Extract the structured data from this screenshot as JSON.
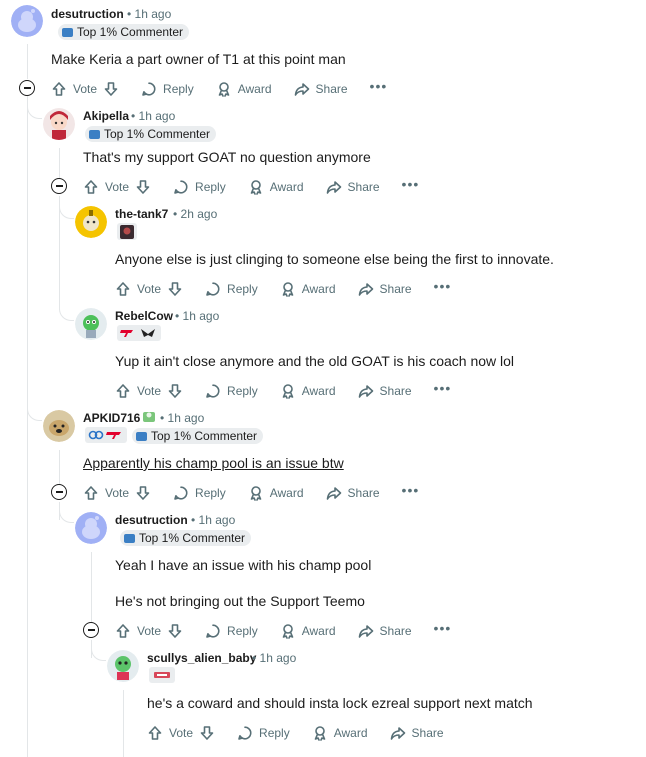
{
  "actions": {
    "vote": "Vote",
    "reply": "Reply",
    "award": "Award",
    "share": "Share"
  },
  "comments": [
    {
      "username": "desutruction",
      "time": "1h ago",
      "flair": "Top 1% Commenter",
      "body": [
        "Make Keria a part owner of T1 at this point man"
      ]
    },
    {
      "username": "Akipella",
      "time": "1h ago",
      "flair": "Top 1% Commenter",
      "body": [
        "That's my support GOAT no question anymore"
      ]
    },
    {
      "username": "the-tank7",
      "time": "2h ago",
      "body": [
        "Anyone else is just clinging to someone else being the first to innovate."
      ]
    },
    {
      "username": "RebelCow",
      "time": "1h ago",
      "body": [
        "Yup it ain't close anymore and the old GOAT is his coach now lol"
      ]
    },
    {
      "username": "APKID716",
      "time": "1h ago",
      "flair": "Top 1% Commenter",
      "body": [
        "Apparently his champ pool is an issue btw"
      ]
    },
    {
      "username": "desutruction",
      "time": "1h ago",
      "flair": "Top 1% Commenter",
      "body": [
        "Yeah I have an issue with his champ pool",
        "He's not bringing out the Support Teemo"
      ]
    },
    {
      "username": "scullys_alien_baby",
      "time": "1h ago",
      "body": [
        "he's a coward and should insta lock ezreal support next match"
      ]
    }
  ],
  "colors": {
    "meta": "#576f76",
    "thread": "#e3e6e8",
    "flair_bg": "#eaedef"
  }
}
